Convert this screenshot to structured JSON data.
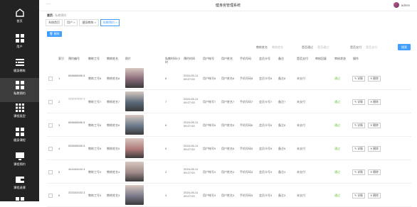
{
  "sidebar": {
    "items": [
      {
        "label": "首页",
        "icon": "home-icon"
      },
      {
        "label": "用户",
        "icon": "grid-icon"
      },
      {
        "label": "健身教练",
        "icon": "list-icon"
      },
      {
        "label": "私教预约",
        "icon": "grid-icon",
        "active": true
      },
      {
        "label": "课程类型",
        "icon": "grid-icon"
      },
      {
        "label": "健身课程",
        "icon": "grid-icon"
      },
      {
        "label": "课程预约",
        "icon": "monitor-icon"
      },
      {
        "label": "课程退课",
        "icon": "wallet-icon"
      },
      {
        "label": "",
        "icon": "grid-icon"
      }
    ]
  },
  "header": {
    "title": "健身房管理系统",
    "collapse": "···",
    "user": "admin"
  },
  "breadcrumb": {
    "home": "首页",
    "current": "私教预约"
  },
  "tabs": [
    {
      "label": "系统首页"
    },
    {
      "label": "用户 ×"
    },
    {
      "label": "健身教练 ×"
    },
    {
      "label": "私教预约 ×",
      "active": true
    }
  ],
  "toolbar": {
    "delete_label": "删除",
    "search_label": "搜索"
  },
  "filters": [
    {
      "label": "教练姓名",
      "placeholder": "教练姓名"
    },
    {
      "label": "是否通过",
      "placeholder": "是否通过"
    },
    {
      "label": "是否支付",
      "placeholder": "是否支付"
    }
  ],
  "table": {
    "headers": [
      "索引",
      "预约编号",
      "教练工号",
      "教练姓名",
      "照片",
      "私教时间/小时",
      "预约时间",
      "用户帐号",
      "用户姓名",
      "手机号码",
      "会员卡号",
      "备注",
      "是否支付",
      "审核回复",
      "审核状态",
      "操作"
    ],
    "rows": [
      {
        "index": "1",
        "no": "888888888 8",
        "coach_no": "教练工号8",
        "coach_name": "教练姓名8",
        "hours": "8",
        "time": "2024-05-11 09:27:03",
        "account": "用户帐号8",
        "name": "用户姓名8",
        "phone": "手机号码8",
        "card": "会员卡号8",
        "remark": "备注8",
        "paid": "未支付",
        "reply": "",
        "status": "通过",
        "photo": "#8a6a7a"
      },
      {
        "index": "2",
        "no": "777777777 7",
        "coach_no": "教练工号7",
        "coach_name": "教练姓名7",
        "hours": "7",
        "time": "2024-05-11 09:27:03",
        "account": "用户帐号7",
        "name": "用户姓名7",
        "phone": "手机号码7",
        "card": "会员卡号7",
        "remark": "备注7",
        "paid": "未支付",
        "reply": "",
        "status": "通过",
        "photo": "#5a6a7a"
      },
      {
        "index": "3",
        "no": "666666666 6",
        "coach_no": "教练工号6",
        "coach_name": "教练姓名6",
        "hours": "6",
        "time": "2024-05-11 09:27:03",
        "account": "用户帐号6",
        "name": "用户姓名6",
        "phone": "手机号码6",
        "card": "会员卡号6",
        "remark": "备注6",
        "paid": "未支付",
        "reply": "",
        "status": "通过",
        "photo": "#6a7a8a"
      },
      {
        "index": "4",
        "no": "555555555 5",
        "coach_no": "教练工号5",
        "coach_name": "教练姓名5",
        "hours": "5",
        "time": "2024-05-11 09:27:03",
        "account": "用户帐号5",
        "name": "用户姓名5",
        "phone": "手机号码5",
        "card": "会员卡号5",
        "remark": "备注5",
        "paid": "未支付",
        "reply": "",
        "status": "通过",
        "photo": "#b07a7a"
      },
      {
        "index": "5",
        "no": "444444444 4",
        "coach_no": "教练工号4",
        "coach_name": "教练姓名4",
        "hours": "4",
        "time": "2024-05-11 09:27:03",
        "account": "用户帐号4",
        "name": "用户姓名4",
        "phone": "手机号码4",
        "card": "会员卡号4",
        "remark": "备注4",
        "paid": "未支付",
        "reply": "",
        "status": "通过",
        "photo": "#a08a8a"
      },
      {
        "index": "6",
        "no": "333333333 3",
        "coach_no": "教练工号3",
        "coach_name": "教练姓名3",
        "hours": "3",
        "time": "2024-05-11 09:27:03",
        "account": "用户帐号3",
        "name": "用户姓名3",
        "phone": "手机号码3",
        "card": "会员卡号3",
        "remark": "备注3",
        "paid": "未支付",
        "reply": "",
        "status": "通过",
        "photo": "#7a7a8a"
      }
    ],
    "edit_label": "✎ 详情",
    "delete_label": "✕ 删除"
  },
  "colors": {
    "sidebar": "#232323",
    "accent": "#409eff",
    "success": "#67c23a"
  }
}
